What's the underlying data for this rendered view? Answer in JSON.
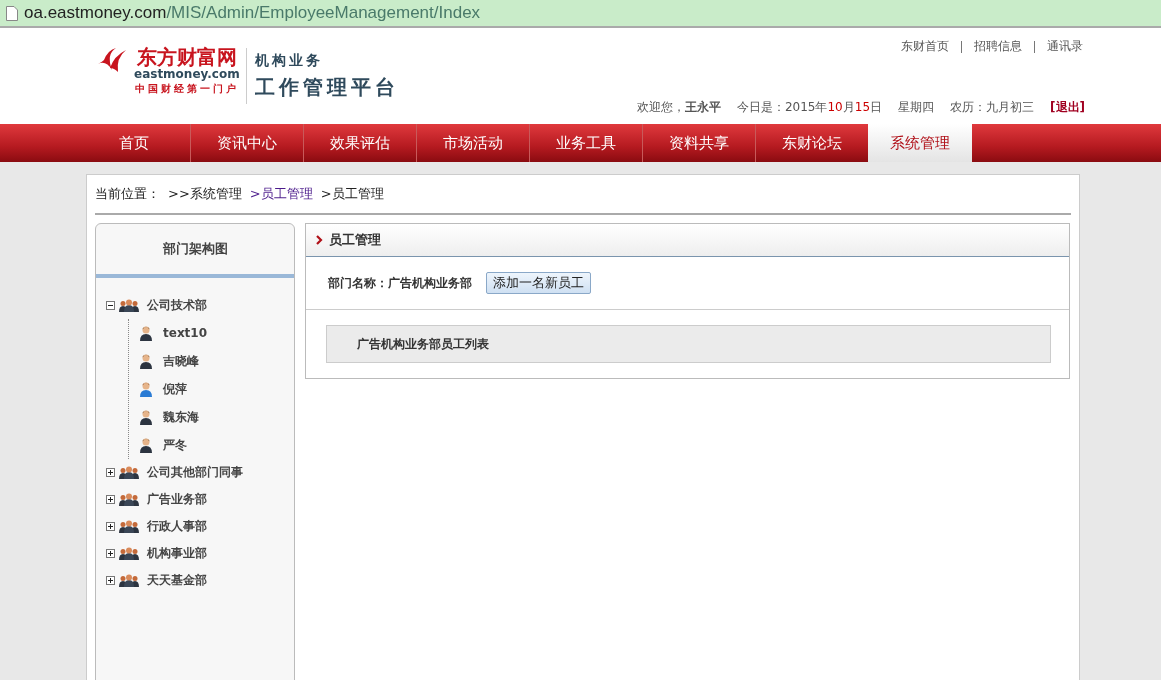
{
  "address_bar": {
    "domain": "oa.eastmoney.com",
    "path": "/MIS/Admin/EmployeeManagement/Index"
  },
  "logo": {
    "name": "东方财富网",
    "site": "eastmoney.com",
    "slogan": "中国财经第一门户"
  },
  "platform": {
    "line1": "机构业务",
    "line2": "工作管理平台"
  },
  "top_links": [
    "东财首页",
    "招聘信息",
    "通讯录"
  ],
  "user_bar": {
    "welcome": "欢迎您，",
    "user": "王永平",
    "date": [
      {
        "text": "今日是：2015年",
        "highlight": false
      },
      {
        "text": "10",
        "highlight": true
      },
      {
        "text": "月",
        "highlight": false
      },
      {
        "text": "15",
        "highlight": true
      },
      {
        "text": "日",
        "highlight": false
      }
    ],
    "weekday": "星期四",
    "lunar": "农历：九月初三",
    "logout": "[退出]"
  },
  "nav": [
    {
      "label": "首页",
      "selected": false
    },
    {
      "label": "资讯中心",
      "selected": false
    },
    {
      "label": "效果评估",
      "selected": false
    },
    {
      "label": "市场活动",
      "selected": false
    },
    {
      "label": "业务工具",
      "selected": false
    },
    {
      "label": "资料共享",
      "selected": false
    },
    {
      "label": "东财论坛",
      "selected": false
    },
    {
      "label": "系统管理",
      "selected": true
    }
  ],
  "breadcrumb": {
    "label": "当前位置：",
    "items": [
      {
        "text": ">>系统管理",
        "link": false
      },
      {
        "text": ">员工管理",
        "link": true
      },
      {
        "text": ">员工管理",
        "link": false
      }
    ]
  },
  "sidebar": {
    "title": "部门架构图",
    "tree": [
      {
        "label": "公司技术部",
        "expanded": true,
        "children": [
          {
            "label": "text10",
            "kind": "male"
          },
          {
            "label": "吉晓峰",
            "kind": "male"
          },
          {
            "label": "倪萍",
            "kind": "female"
          },
          {
            "label": "魏东海",
            "kind": "male"
          },
          {
            "label": "严冬",
            "kind": "male"
          }
        ]
      },
      {
        "label": "公司其他部门同事",
        "expanded": false
      },
      {
        "label": "广告业务部",
        "expanded": false
      },
      {
        "label": "行政人事部",
        "expanded": false
      },
      {
        "label": "机构事业部",
        "expanded": false
      },
      {
        "label": "天天基金部",
        "expanded": false
      }
    ]
  },
  "panel": {
    "title": "员工管理",
    "department_label": "部门名称：",
    "department": "广告机构业务部",
    "add_button": "添加一名新员工",
    "list_title": "广告机构业务部员工列表"
  }
}
